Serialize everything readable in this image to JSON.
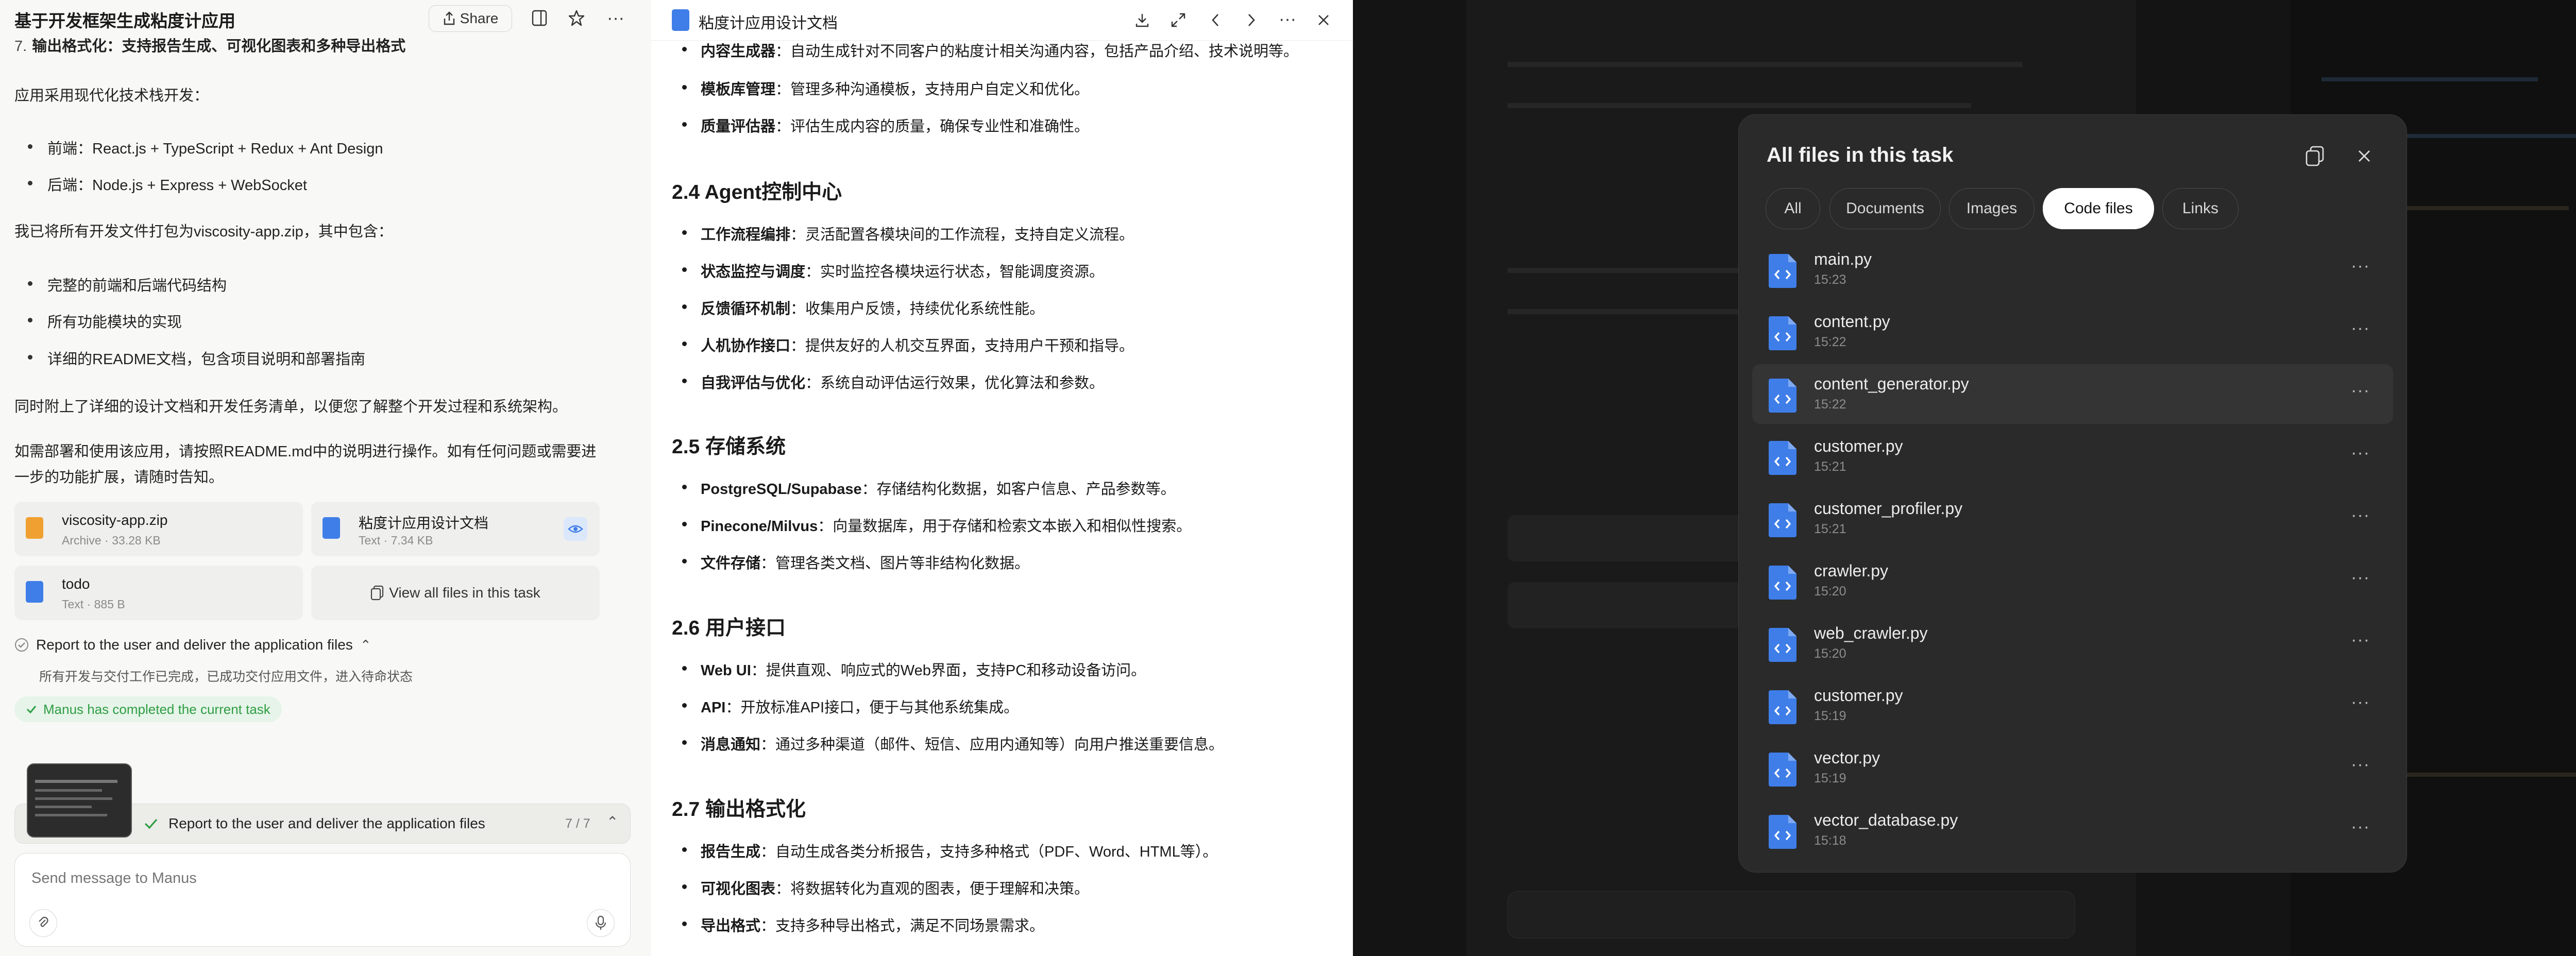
{
  "left": {
    "title": "基于开发框架生成粘度计应用",
    "share_label": "Share",
    "lines": {
      "item7": "输出格式化：支持报告生成、可视化图表和多种导出格式",
      "stack_intro": "应用采用现代化技术栈开发：",
      "frontend": "前端：React.js + TypeScript + Redux + Ant Design",
      "backend": "后端：Node.js + Express + WebSocket",
      "pack": "我已将所有开发文件打包为viscosity-app.zip，其中包含：",
      "inc1": "完整的前端和后端代码结构",
      "inc2": "所有功能模块的实现",
      "inc3": "详细的README文档，包含项目说明和部署指南",
      "attach": "同时附上了详细的设计文档和开发任务清单，以便您了解整个开发过程和系统架构。",
      "deploy1": "如需部署和使用该应用，请按照README.md中的说明进行操作。如有任何问题或需要进",
      "deploy2": "一步的功能扩展，请随时告知。"
    },
    "attachments": [
      {
        "name": "viscosity-app.zip",
        "meta": "Archive · 33.28 KB"
      },
      {
        "name": "粘度计应用设计文档",
        "meta": "Text · 7.34 KB"
      },
      {
        "name": "todo",
        "meta": "Text · 885 B"
      }
    ],
    "view_all_label": "View all files in this task",
    "step_title": "Report to the user and deliver the application files",
    "step_desc": "所有开发与交付工作已完成，已成功交付应用文件，进入待命状态",
    "completed": "Manus has completed the current task",
    "progress_title": "Report to the user and deliver the application files",
    "progress_count": "7 / 7",
    "input_placeholder": "Send message to Manus"
  },
  "doc": {
    "title": "粘度计应用设计文档",
    "top_items": [
      {
        "b": "内容生成器",
        "t": "：自动生成针对不同客户的粘度计相关沟通内容，包括产品介绍、技术说明等。"
      },
      {
        "b": "模板库管理",
        "t": "：管理多种沟通模板，支持用户自定义和优化。"
      },
      {
        "b": "质量评估器",
        "t": "：评估生成内容的质量，确保专业性和准确性。"
      }
    ],
    "sections": [
      {
        "h": "2.4 Agent控制中心",
        "items": [
          {
            "b": "工作流程编排",
            "t": "：灵活配置各模块间的工作流程，支持自定义流程。"
          },
          {
            "b": "状态监控与调度",
            "t": "：实时监控各模块运行状态，智能调度资源。"
          },
          {
            "b": "反馈循环机制",
            "t": "：收集用户反馈，持续优化系统性能。"
          },
          {
            "b": "人机协作接口",
            "t": "：提供友好的人机交互界面，支持用户干预和指导。"
          },
          {
            "b": "自我评估与优化",
            "t": "：系统自动评估运行效果，优化算法和参数。"
          }
        ]
      },
      {
        "h": "2.5 存储系统",
        "items": [
          {
            "b": "PostgreSQL/Supabase",
            "t": "：存储结构化数据，如客户信息、产品参数等。"
          },
          {
            "b": "Pinecone/Milvus",
            "t": "：向量数据库，用于存储和检索文本嵌入和相似性搜索。"
          },
          {
            "b": "文件存储",
            "t": "：管理各类文档、图片等非结构化数据。"
          }
        ]
      },
      {
        "h": "2.6 用户接口",
        "items": [
          {
            "b": "Web UI",
            "t": "：提供直观、响应式的Web界面，支持PC和移动设备访问。"
          },
          {
            "b": "API",
            "t": "：开放标准API接口，便于与其他系统集成。"
          },
          {
            "b": "消息通知",
            "t": "：通过多种渠道（邮件、短信、应用内通知等）向用户推送重要信息。"
          }
        ]
      },
      {
        "h": "2.7 输出格式化",
        "items": [
          {
            "b": "报告生成",
            "t": "：自动生成各类分析报告，支持多种格式（PDF、Word、HTML等）。"
          },
          {
            "b": "可视化图表",
            "t": "：将数据转化为直观的图表，便于理解和决策。"
          },
          {
            "b": "导出格式",
            "t": "：支持多种导出格式，满足不同场景需求。"
          }
        ]
      }
    ]
  },
  "modal": {
    "title": "All files in this task",
    "tabs": [
      "All",
      "Documents",
      "Images",
      "Code files",
      "Links"
    ],
    "active_tab": "Code files",
    "files": [
      {
        "name": "main.py",
        "time": "15:23"
      },
      {
        "name": "content.py",
        "time": "15:22"
      },
      {
        "name": "content_generator.py",
        "time": "15:22"
      },
      {
        "name": "customer.py",
        "time": "15:21"
      },
      {
        "name": "customer_profiler.py",
        "time": "15:21"
      },
      {
        "name": "crawler.py",
        "time": "15:20"
      },
      {
        "name": "web_crawler.py",
        "time": "15:20"
      },
      {
        "name": "customer.py",
        "time": "15:19"
      },
      {
        "name": "vector.py",
        "time": "15:19"
      },
      {
        "name": "vector_database.py",
        "time": "15:18"
      }
    ]
  },
  "colors": {
    "accent_blue": "#3f7ee8",
    "zip_orange": "#f0a030",
    "success_green": "#2f9e44",
    "modal_bg": "#2a2a2a"
  },
  "icons": [
    "share-icon",
    "sidebar-icon",
    "star-icon",
    "more-icon",
    "doc-icon",
    "download-icon",
    "expand-icon",
    "chevron-left-icon",
    "chevron-right-icon",
    "close-icon",
    "copy-icon",
    "paperclip-icon",
    "mic-icon",
    "check-icon",
    "eye-icon",
    "code-file-icon"
  ]
}
